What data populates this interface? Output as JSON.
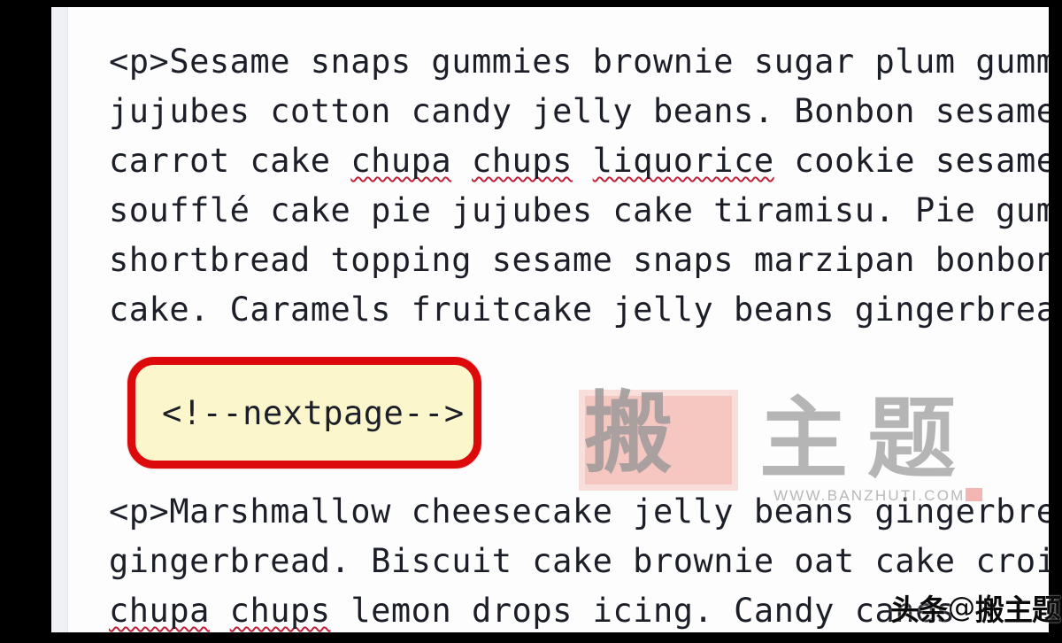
{
  "editor": {
    "top_block": {
      "lines": [
        [
          {
            "text": "<p>Sesame snaps gummies brownie sugar plum gummies je",
            "misspelled": false
          }
        ],
        [
          {
            "text": "jujubes cotton candy jelly beans. Bonbon sesame snaps",
            "misspelled": false
          }
        ],
        [
          {
            "text": "carrot cake ",
            "misspelled": false
          },
          {
            "text": "chupa",
            "misspelled": true
          },
          {
            "text": " ",
            "misspelled": false
          },
          {
            "text": "chups",
            "misspelled": true
          },
          {
            "text": " ",
            "misspelled": false
          },
          {
            "text": "liquorice",
            "misspelled": true
          },
          {
            "text": " cookie sesame snaps",
            "misspelled": false
          }
        ],
        [
          {
            "text": "soufflé cake pie jujubes cake tiramisu. Pie gummi bea",
            "misspelled": false
          }
        ],
        [
          {
            "text": "shortbread topping sesame snaps marzipan bonbon gummi",
            "misspelled": false
          }
        ],
        [
          {
            "text": "cake. Caramels fruitcake jelly beans gingerbread cake",
            "misspelled": false
          }
        ]
      ]
    },
    "bottom_block": {
      "lines": [
        [
          {
            "text": "<p>Marshmallow cheesecake jelly beans gingerbread oat",
            "misspelled": false
          }
        ],
        [
          {
            "text": "gingerbread. Biscuit cake brownie oat cake croissant",
            "misspelled": false
          }
        ],
        [
          {
            "text": "chupa",
            "misspelled": true
          },
          {
            "text": " ",
            "misspelled": false
          },
          {
            "text": "chups",
            "misspelled": true
          },
          {
            "text": " lemon drops icing. Candy canes ",
            "misspelled": false
          }
        ]
      ]
    }
  },
  "annotation": {
    "text": "<!--nextpage-->",
    "border_color": "#dc0a0a",
    "fill_color": "#fbf6cc"
  },
  "watermark": {
    "char_1": "搬",
    "char_2": "主",
    "char_3": "题",
    "url": "WWW.BANZHUTI.COM",
    "stamp_color": "#f2a59b",
    "text_color": "#707070"
  },
  "badge": {
    "platform": "头条",
    "at": "@",
    "handle": "搬主题"
  }
}
